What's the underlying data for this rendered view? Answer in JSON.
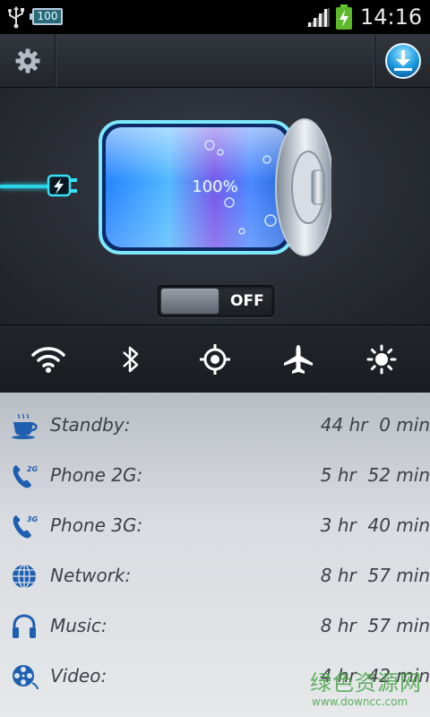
{
  "status_bar": {
    "battery_level": "100",
    "time": "14:16",
    "icons": [
      "usb-icon",
      "battery-icon",
      "signal-icon",
      "charging-icon"
    ]
  },
  "toolbar": {
    "left_icon": "gear-icon",
    "right_icon": "download-icon"
  },
  "battery": {
    "percent_label": "100%",
    "charging": true,
    "level": 1.0,
    "toggle_label": "OFF"
  },
  "quick_settings": [
    {
      "icon": "wifi-icon"
    },
    {
      "icon": "bluetooth-icon"
    },
    {
      "icon": "gps-icon"
    },
    {
      "icon": "airplane-icon"
    },
    {
      "icon": "brightness-icon"
    }
  ],
  "usage": [
    {
      "label": "Standby:",
      "value": "44 hr  0 min",
      "icon": "coffee-cup-icon"
    },
    {
      "label": "Phone 2G:",
      "value": "5 hr  52 min",
      "icon": "phone-2g-icon"
    },
    {
      "label": "Phone 3G:",
      "value": "3 hr  40 min",
      "icon": "phone-3g-icon"
    },
    {
      "label": "Network:",
      "value": "8 hr  57 min",
      "icon": "globe-icon"
    },
    {
      "label": "Music:",
      "value": "8 hr  57 min",
      "icon": "headphones-icon"
    },
    {
      "label": "Video:",
      "value": "4 hr  42 min",
      "icon": "film-reel-icon"
    }
  ],
  "watermark": {
    "line1": "绿色资源网",
    "line2": "www.downcc.com"
  },
  "colors": {
    "accent_cyan": "#2ee8ff",
    "list_text": "#3d4046",
    "icon_blue": "#1f5fb0"
  }
}
